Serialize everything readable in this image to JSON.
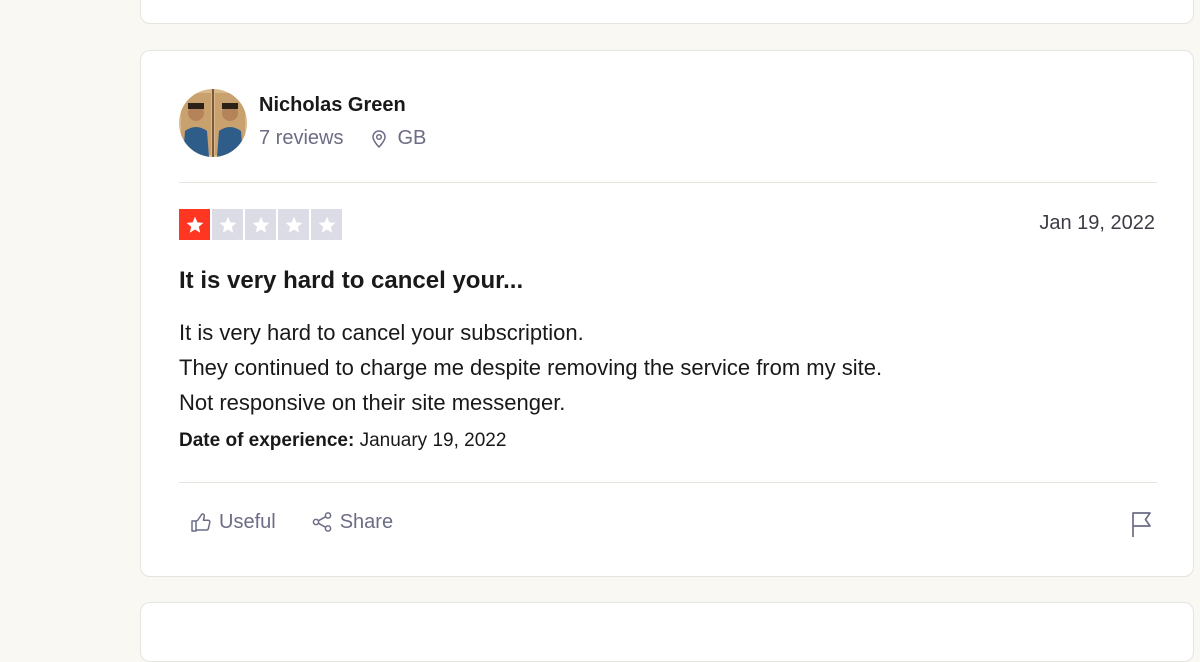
{
  "reviewer": {
    "name": "Nicholas Green",
    "review_count": "7 reviews",
    "country": "GB"
  },
  "review": {
    "rating": 1,
    "max_rating": 5,
    "date": "Jan 19, 2022",
    "title": "It is very hard to cancel your...",
    "body_lines": [
      "It is very hard to cancel your subscription.",
      "They continued to charge me despite removing the service from my site.",
      "Not responsive on their site messenger."
    ],
    "experience_label": "Date of experience:",
    "experience_date": "January 19, 2022"
  },
  "actions": {
    "useful_label": "Useful",
    "share_label": "Share"
  },
  "colors": {
    "star_filled": "#ff3722",
    "star_empty": "#dcdce6",
    "muted_text": "#6c6c85"
  },
  "icons": {
    "location": "location-pin-icon",
    "useful": "thumbs-up-icon",
    "share": "share-icon",
    "flag": "flag-icon"
  }
}
